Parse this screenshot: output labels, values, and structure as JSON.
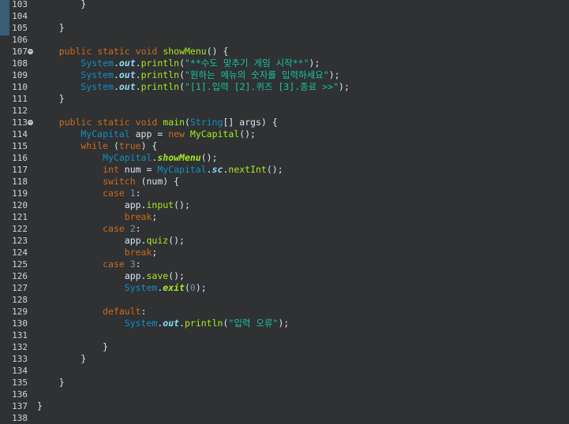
{
  "colors": {
    "background": "#2f3133",
    "line_number": "#d4d4d4",
    "keyword": "#cc6c1d",
    "type": "#1290c3",
    "method": "#a7ec21",
    "method_call": "#a7ec21",
    "field": "#8ddaf8",
    "string": "#17c6a3",
    "number": "#6897bb",
    "plain": "#d9e8f7"
  },
  "editor": {
    "lines": [
      {
        "num": "103",
        "fold": false,
        "tokens": [
          {
            "t": "        }",
            "c": "plain"
          }
        ]
      },
      {
        "num": "104",
        "fold": false,
        "tokens": []
      },
      {
        "num": "105",
        "fold": false,
        "tokens": [
          {
            "t": "    }",
            "c": "plain"
          }
        ]
      },
      {
        "num": "106",
        "fold": false,
        "tokens": []
      },
      {
        "num": "107",
        "fold": true,
        "tokens": [
          {
            "t": "    ",
            "c": "plain"
          },
          {
            "t": "public",
            "c": "keyword"
          },
          {
            "t": " ",
            "c": "plain"
          },
          {
            "t": "static",
            "c": "keyword"
          },
          {
            "t": " ",
            "c": "plain"
          },
          {
            "t": "void",
            "c": "keyword"
          },
          {
            "t": " ",
            "c": "plain"
          },
          {
            "t": "showMenu",
            "c": "method"
          },
          {
            "t": "() {",
            "c": "plain"
          }
        ]
      },
      {
        "num": "108",
        "fold": false,
        "tokens": [
          {
            "t": "        ",
            "c": "plain"
          },
          {
            "t": "System",
            "c": "type"
          },
          {
            "t": ".",
            "c": "plain"
          },
          {
            "t": "out",
            "c": "field",
            "i": true
          },
          {
            "t": ".",
            "c": "plain"
          },
          {
            "t": "println",
            "c": "method_call"
          },
          {
            "t": "(",
            "c": "plain"
          },
          {
            "t": "\"**수도 맞추기 게임 시작**\"",
            "c": "string"
          },
          {
            "t": ");",
            "c": "plain"
          }
        ]
      },
      {
        "num": "109",
        "fold": false,
        "tokens": [
          {
            "t": "        ",
            "c": "plain"
          },
          {
            "t": "System",
            "c": "type"
          },
          {
            "t": ".",
            "c": "plain"
          },
          {
            "t": "out",
            "c": "field",
            "i": true
          },
          {
            "t": ".",
            "c": "plain"
          },
          {
            "t": "println",
            "c": "method_call"
          },
          {
            "t": "(",
            "c": "plain"
          },
          {
            "t": "\"원하는 메뉴의 숫자를 입력하세요\"",
            "c": "string"
          },
          {
            "t": ");",
            "c": "plain"
          }
        ]
      },
      {
        "num": "110",
        "fold": false,
        "tokens": [
          {
            "t": "        ",
            "c": "plain"
          },
          {
            "t": "System",
            "c": "type"
          },
          {
            "t": ".",
            "c": "plain"
          },
          {
            "t": "out",
            "c": "field",
            "i": true
          },
          {
            "t": ".",
            "c": "plain"
          },
          {
            "t": "println",
            "c": "method_call"
          },
          {
            "t": "(",
            "c": "plain"
          },
          {
            "t": "\"[1].입력 [2].퀴즈 [3].종료 >>\"",
            "c": "string"
          },
          {
            "t": ");",
            "c": "plain"
          }
        ]
      },
      {
        "num": "111",
        "fold": false,
        "tokens": [
          {
            "t": "    }",
            "c": "plain"
          }
        ]
      },
      {
        "num": "112",
        "fold": false,
        "tokens": []
      },
      {
        "num": "113",
        "fold": true,
        "tokens": [
          {
            "t": "    ",
            "c": "plain"
          },
          {
            "t": "public",
            "c": "keyword"
          },
          {
            "t": " ",
            "c": "plain"
          },
          {
            "t": "static",
            "c": "keyword"
          },
          {
            "t": " ",
            "c": "plain"
          },
          {
            "t": "void",
            "c": "keyword"
          },
          {
            "t": " ",
            "c": "plain"
          },
          {
            "t": "main",
            "c": "method"
          },
          {
            "t": "(",
            "c": "plain"
          },
          {
            "t": "String",
            "c": "type"
          },
          {
            "t": "[] ",
            "c": "plain"
          },
          {
            "t": "args",
            "c": "plain"
          },
          {
            "t": ") {",
            "c": "plain"
          }
        ]
      },
      {
        "num": "114",
        "fold": false,
        "tokens": [
          {
            "t": "        ",
            "c": "plain"
          },
          {
            "t": "MyCapital",
            "c": "type"
          },
          {
            "t": " app = ",
            "c": "plain"
          },
          {
            "t": "new",
            "c": "keyword"
          },
          {
            "t": " ",
            "c": "plain"
          },
          {
            "t": "MyCapital",
            "c": "method_call"
          },
          {
            "t": "();",
            "c": "plain"
          }
        ]
      },
      {
        "num": "115",
        "fold": false,
        "tokens": [
          {
            "t": "        ",
            "c": "plain"
          },
          {
            "t": "while",
            "c": "keyword"
          },
          {
            "t": " (",
            "c": "plain"
          },
          {
            "t": "true",
            "c": "keyword"
          },
          {
            "t": ") {",
            "c": "plain"
          }
        ]
      },
      {
        "num": "116",
        "fold": false,
        "tokens": [
          {
            "t": "            ",
            "c": "plain"
          },
          {
            "t": "MyCapital",
            "c": "type"
          },
          {
            "t": ".",
            "c": "plain"
          },
          {
            "t": "showMenu",
            "c": "method_call",
            "i": true
          },
          {
            "t": "();",
            "c": "plain"
          }
        ]
      },
      {
        "num": "117",
        "fold": false,
        "tokens": [
          {
            "t": "            ",
            "c": "plain"
          },
          {
            "t": "int",
            "c": "keyword"
          },
          {
            "t": " num = ",
            "c": "plain"
          },
          {
            "t": "MyCapital",
            "c": "type"
          },
          {
            "t": ".",
            "c": "plain"
          },
          {
            "t": "sc",
            "c": "field",
            "i": true
          },
          {
            "t": ".",
            "c": "plain"
          },
          {
            "t": "nextInt",
            "c": "method_call"
          },
          {
            "t": "();",
            "c": "plain"
          }
        ]
      },
      {
        "num": "118",
        "fold": false,
        "tokens": [
          {
            "t": "            ",
            "c": "plain"
          },
          {
            "t": "switch",
            "c": "keyword"
          },
          {
            "t": " (num) {",
            "c": "plain"
          }
        ]
      },
      {
        "num": "119",
        "fold": false,
        "tokens": [
          {
            "t": "            ",
            "c": "plain"
          },
          {
            "t": "case",
            "c": "keyword"
          },
          {
            "t": " ",
            "c": "plain"
          },
          {
            "t": "1",
            "c": "number"
          },
          {
            "t": ":",
            "c": "plain"
          }
        ]
      },
      {
        "num": "120",
        "fold": false,
        "tokens": [
          {
            "t": "                app.",
            "c": "plain"
          },
          {
            "t": "input",
            "c": "method_call"
          },
          {
            "t": "();",
            "c": "plain"
          }
        ]
      },
      {
        "num": "121",
        "fold": false,
        "tokens": [
          {
            "t": "                ",
            "c": "plain"
          },
          {
            "t": "break",
            "c": "keyword"
          },
          {
            "t": ";",
            "c": "plain"
          }
        ]
      },
      {
        "num": "122",
        "fold": false,
        "tokens": [
          {
            "t": "            ",
            "c": "plain"
          },
          {
            "t": "case",
            "c": "keyword"
          },
          {
            "t": " ",
            "c": "plain"
          },
          {
            "t": "2",
            "c": "number"
          },
          {
            "t": ":",
            "c": "plain"
          }
        ]
      },
      {
        "num": "123",
        "fold": false,
        "tokens": [
          {
            "t": "                app.",
            "c": "plain"
          },
          {
            "t": "quiz",
            "c": "method_call"
          },
          {
            "t": "();",
            "c": "plain"
          }
        ]
      },
      {
        "num": "124",
        "fold": false,
        "tokens": [
          {
            "t": "                ",
            "c": "plain"
          },
          {
            "t": "break",
            "c": "keyword"
          },
          {
            "t": ";",
            "c": "plain"
          }
        ]
      },
      {
        "num": "125",
        "fold": false,
        "tokens": [
          {
            "t": "            ",
            "c": "plain"
          },
          {
            "t": "case",
            "c": "keyword"
          },
          {
            "t": " ",
            "c": "plain"
          },
          {
            "t": "3",
            "c": "number"
          },
          {
            "t": ":",
            "c": "plain"
          }
        ]
      },
      {
        "num": "126",
        "fold": false,
        "tokens": [
          {
            "t": "                app.",
            "c": "plain"
          },
          {
            "t": "save",
            "c": "method_call"
          },
          {
            "t": "();",
            "c": "plain"
          }
        ]
      },
      {
        "num": "127",
        "fold": false,
        "tokens": [
          {
            "t": "                ",
            "c": "plain"
          },
          {
            "t": "System",
            "c": "type"
          },
          {
            "t": ".",
            "c": "plain"
          },
          {
            "t": "exit",
            "c": "method_call",
            "i": true
          },
          {
            "t": "(",
            "c": "plain"
          },
          {
            "t": "0",
            "c": "number"
          },
          {
            "t": ");",
            "c": "plain"
          }
        ]
      },
      {
        "num": "128",
        "fold": false,
        "tokens": []
      },
      {
        "num": "129",
        "fold": false,
        "tokens": [
          {
            "t": "            ",
            "c": "plain"
          },
          {
            "t": "default",
            "c": "keyword"
          },
          {
            "t": ":",
            "c": "plain"
          }
        ]
      },
      {
        "num": "130",
        "fold": false,
        "tokens": [
          {
            "t": "                ",
            "c": "plain"
          },
          {
            "t": "System",
            "c": "type"
          },
          {
            "t": ".",
            "c": "plain"
          },
          {
            "t": "out",
            "c": "field",
            "i": true
          },
          {
            "t": ".",
            "c": "plain"
          },
          {
            "t": "println",
            "c": "method_call"
          },
          {
            "t": "(",
            "c": "plain"
          },
          {
            "t": "\"입력 오류\"",
            "c": "string"
          },
          {
            "t": ");",
            "c": "plain"
          }
        ]
      },
      {
        "num": "131",
        "fold": false,
        "tokens": []
      },
      {
        "num": "132",
        "fold": false,
        "tokens": [
          {
            "t": "            }",
            "c": "plain"
          }
        ]
      },
      {
        "num": "133",
        "fold": false,
        "tokens": [
          {
            "t": "        }",
            "c": "plain"
          }
        ]
      },
      {
        "num": "134",
        "fold": false,
        "tokens": []
      },
      {
        "num": "135",
        "fold": false,
        "tokens": [
          {
            "t": "    }",
            "c": "plain"
          }
        ]
      },
      {
        "num": "136",
        "fold": false,
        "tokens": []
      },
      {
        "num": "137",
        "fold": false,
        "tokens": [
          {
            "t": "}",
            "c": "plain"
          }
        ]
      },
      {
        "num": "138",
        "fold": false,
        "tokens": []
      }
    ]
  }
}
